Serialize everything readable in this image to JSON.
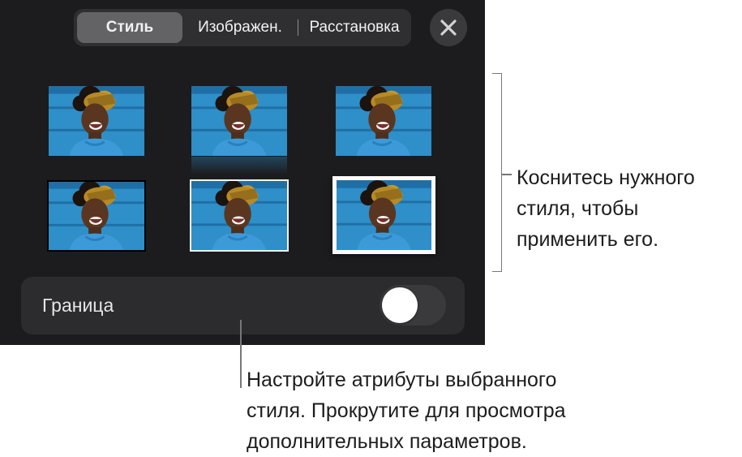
{
  "tabs": [
    {
      "label": "Стиль",
      "selected": true
    },
    {
      "label": "Изображен.",
      "selected": false
    },
    {
      "label": "Расстановка",
      "selected": false
    }
  ],
  "close_icon": "close-icon",
  "style_presets": [
    "style-plain",
    "style-reflection",
    "style-shadow",
    "style-black-border",
    "style-white-thin-border",
    "style-white-frame"
  ],
  "border": {
    "label": "Граница",
    "enabled": false
  },
  "callouts": {
    "right": [
      "Коснитесь нужного",
      "стиля, чтобы",
      "применить его."
    ],
    "bottom": [
      "Настройте атрибуты выбранного",
      "стиля. Прокрутите для просмотра",
      "дополнительных параметров."
    ]
  },
  "colors": {
    "panel": "#1c1c1e",
    "selected_tab": "#636366",
    "photo_bg": "#2f8fc8"
  }
}
